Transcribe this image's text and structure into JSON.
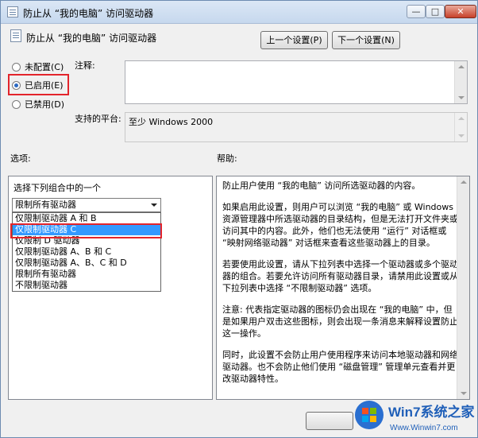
{
  "window": {
    "title": "防止从 “我的电脑” 访问驱动器",
    "btn_min": "—",
    "btn_max": "□",
    "btn_close": "✕"
  },
  "header": {
    "title": "防止从 “我的电脑” 访问驱动器",
    "prev_btn": "上一个设置(P)",
    "next_btn": "下一个设置(N)"
  },
  "radios": [
    {
      "label": "未配置(C)",
      "checked": false
    },
    {
      "label": "已启用(E)",
      "checked": true
    },
    {
      "label": "已禁用(D)",
      "checked": false
    }
  ],
  "comment_label": "注释:",
  "platform_label": "支持的平台:",
  "platform_value": "至少 Windows 2000",
  "options_label": "选项:",
  "help_label": "帮助:",
  "options": {
    "combo_prompt": "选择下列组合中的一个",
    "selected": "限制所有驱动器",
    "items": [
      "仅限制驱动器 A 和 B",
      "仅限制驱动器 C",
      "仅限制 D 驱动器",
      "仅限制驱动器 A、B 和 C",
      "仅限制驱动器 A、B、C 和 D",
      "限制所有驱动器",
      "不限制驱动器"
    ],
    "highlighted_index": 1
  },
  "help": {
    "paragraphs": [
      "防止用户使用 “我的电脑” 访问所选驱动器的内容。",
      "如果启用此设置，则用户可以浏览 “我的电脑” 或 Windows 资源管理器中所选驱动器的目录结构，但是无法打开文件夹或访问其中的内容。此外，他们也无法使用 “运行” 对话框或 “映射网络驱动器” 对话框来查看这些驱动器上的目录。",
      "若要使用此设置，请从下拉列表中选择一个驱动器或多个驱动器的组合。若要允许访问所有驱动器目录，请禁用此设置或从下拉列表中选择 “不限制驱动器” 选项。",
      "注意: 代表指定驱动器的图标仍会出现在 “我的电脑” 中，但是如果用户双击这些图标，则会出现一条消息来解释设置防止这一操作。",
      "同时，此设置不会防止用户使用程序来访问本地驱动器和网络驱动器。也不会防止他们使用 “磁盘管理” 管理单元查看并更改驱动器特性。"
    ]
  },
  "watermark": {
    "brand": "Win7系统之家",
    "url": "Www.Winwin7.com"
  }
}
